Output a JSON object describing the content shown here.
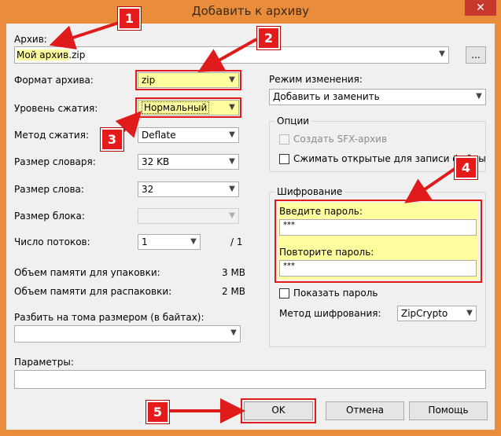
{
  "window": {
    "title": "Добавить к архиву",
    "close_label": "✕"
  },
  "archive": {
    "label": "Архив:",
    "value_highlight": "Мой архив",
    "value_rest": ".zip",
    "browse_label": "..."
  },
  "left": {
    "format_label": "Формат архива:",
    "format_value": "zip",
    "level_label": "Уровень сжатия:",
    "level_value": "Нормальный",
    "method_label": "Метод сжатия:",
    "method_value": "Deflate",
    "dict_label": "Размер словаря:",
    "dict_value": "32 KB",
    "word_label": "Размер слова:",
    "word_value": "32",
    "block_label": "Размер блока:",
    "block_value": "",
    "threads_label": "Число потоков:",
    "threads_value": "1",
    "threads_max": "/ 1",
    "mem_pack_label": "Объем памяти для упаковки:",
    "mem_pack_value": "3 MB",
    "mem_unpack_label": "Объем памяти для распаковки:",
    "mem_unpack_value": "2 MB",
    "split_label": "Разбить на тома размером (в байтах):",
    "split_value": "",
    "params_label": "Параметры:",
    "params_value": ""
  },
  "right": {
    "update_mode_label": "Режим изменения:",
    "update_mode_value": "Добавить и заменить",
    "options_title": "Опции",
    "sfx_label": "Создать SFX-архив",
    "compress_shared_label": "Сжимать открытые для записи файлы",
    "encryption_title": "Шифрование",
    "password_label": "Введите пароль:",
    "password_value": "***",
    "repeat_label": "Повторите пароль:",
    "repeat_value": "***",
    "show_password_label": "Показать пароль",
    "enc_method_label": "Метод шифрования:",
    "enc_method_value": "ZipCrypto"
  },
  "buttons": {
    "ok": "OK",
    "cancel": "Отмена",
    "help": "Помощь"
  },
  "annotations": {
    "badge1": "1",
    "badge2": "2",
    "badge3": "3",
    "badge4": "4",
    "badge5": "5"
  },
  "colors": {
    "title_bar": "#e98c3c",
    "highlight": "#fffe9e",
    "annotation_red": "#e01b1b"
  },
  "icons": {
    "dropdown": "chevron-down-icon",
    "close": "close-icon"
  }
}
